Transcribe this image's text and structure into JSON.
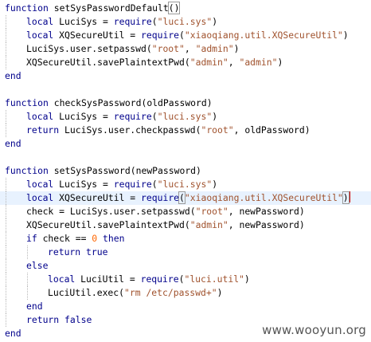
{
  "editor": {
    "current_line": 14,
    "lines": [
      {
        "indent": 0,
        "tokens": [
          {
            "t": "kw",
            "v": "function"
          },
          {
            "t": "plain",
            "v": " setSysPasswordDefault"
          },
          {
            "t": "paren",
            "v": "()"
          }
        ]
      },
      {
        "indent": 1,
        "tokens": [
          {
            "t": "kw",
            "v": "local"
          },
          {
            "t": "plain",
            "v": " LuciSys = "
          },
          {
            "t": "kw",
            "v": "require"
          },
          {
            "t": "plain",
            "v": "("
          },
          {
            "t": "str",
            "v": "\"luci.sys\""
          },
          {
            "t": "plain",
            "v": ")"
          }
        ]
      },
      {
        "indent": 1,
        "tokens": [
          {
            "t": "kw",
            "v": "local"
          },
          {
            "t": "plain",
            "v": " XQSecureUtil = "
          },
          {
            "t": "kw",
            "v": "require"
          },
          {
            "t": "plain",
            "v": "("
          },
          {
            "t": "str",
            "v": "\"xiaoqiang.util.XQSecureUtil\""
          },
          {
            "t": "plain",
            "v": ")"
          }
        ]
      },
      {
        "indent": 1,
        "tokens": [
          {
            "t": "plain",
            "v": "LuciSys.user.setpasswd("
          },
          {
            "t": "str",
            "v": "\"root\""
          },
          {
            "t": "plain",
            "v": ", "
          },
          {
            "t": "str",
            "v": "\"admin\""
          },
          {
            "t": "plain",
            "v": ")"
          }
        ]
      },
      {
        "indent": 1,
        "tokens": [
          {
            "t": "plain",
            "v": "XQSecureUtil.savePlaintextPwd("
          },
          {
            "t": "str",
            "v": "\"admin\""
          },
          {
            "t": "plain",
            "v": ", "
          },
          {
            "t": "str",
            "v": "\"admin\""
          },
          {
            "t": "plain",
            "v": ")"
          }
        ]
      },
      {
        "indent": 0,
        "tokens": [
          {
            "t": "kw",
            "v": "end"
          }
        ]
      },
      {
        "indent": 0,
        "tokens": []
      },
      {
        "indent": 0,
        "tokens": [
          {
            "t": "kw",
            "v": "function"
          },
          {
            "t": "plain",
            "v": " checkSysPassword(oldPassword)"
          }
        ]
      },
      {
        "indent": 1,
        "tokens": [
          {
            "t": "kw",
            "v": "local"
          },
          {
            "t": "plain",
            "v": " LuciSys = "
          },
          {
            "t": "kw",
            "v": "require"
          },
          {
            "t": "plain",
            "v": "("
          },
          {
            "t": "str",
            "v": "\"luci.sys\""
          },
          {
            "t": "plain",
            "v": ")"
          }
        ]
      },
      {
        "indent": 1,
        "tokens": [
          {
            "t": "kw",
            "v": "return"
          },
          {
            "t": "plain",
            "v": " LuciSys.user.checkpasswd("
          },
          {
            "t": "str",
            "v": "\"root\""
          },
          {
            "t": "plain",
            "v": ", oldPassword)"
          }
        ]
      },
      {
        "indent": 0,
        "tokens": [
          {
            "t": "kw",
            "v": "end"
          }
        ]
      },
      {
        "indent": 0,
        "tokens": []
      },
      {
        "indent": 0,
        "tokens": [
          {
            "t": "kw",
            "v": "function"
          },
          {
            "t": "plain",
            "v": " setSysPassword(newPassword)"
          }
        ]
      },
      {
        "indent": 1,
        "tokens": [
          {
            "t": "kw",
            "v": "local"
          },
          {
            "t": "plain",
            "v": " LuciSys = "
          },
          {
            "t": "kw",
            "v": "require"
          },
          {
            "t": "plain",
            "v": "("
          },
          {
            "t": "str",
            "v": "\"luci.sys\""
          },
          {
            "t": "plain",
            "v": ")"
          }
        ]
      },
      {
        "indent": 1,
        "tokens": [
          {
            "t": "kw",
            "v": "local"
          },
          {
            "t": "plain",
            "v": " XQSecureUtil = "
          },
          {
            "t": "kw",
            "v": "require"
          },
          {
            "t": "paren",
            "v": "("
          },
          {
            "t": "str",
            "v": "\"xiaoqiang.util.XQSecureUtil\""
          },
          {
            "t": "paren",
            "v": ")"
          },
          {
            "t": "caret",
            "v": ""
          }
        ]
      },
      {
        "indent": 1,
        "tokens": [
          {
            "t": "plain",
            "v": "check = LuciSys.user.setpasswd("
          },
          {
            "t": "str",
            "v": "\"root\""
          },
          {
            "t": "plain",
            "v": ", newPassword)"
          }
        ]
      },
      {
        "indent": 1,
        "tokens": [
          {
            "t": "plain",
            "v": "XQSecureUtil.savePlaintextPwd("
          },
          {
            "t": "str",
            "v": "\"admin\""
          },
          {
            "t": "plain",
            "v": ", newPassword)"
          }
        ]
      },
      {
        "indent": 1,
        "tokens": [
          {
            "t": "kw",
            "v": "if"
          },
          {
            "t": "plain",
            "v": " check == "
          },
          {
            "t": "num",
            "v": "0"
          },
          {
            "t": "plain",
            "v": " "
          },
          {
            "t": "kw",
            "v": "then"
          }
        ]
      },
      {
        "indent": 2,
        "tokens": [
          {
            "t": "kw",
            "v": "return"
          },
          {
            "t": "plain",
            "v": " "
          },
          {
            "t": "kw",
            "v": "true"
          }
        ]
      },
      {
        "indent": 1,
        "tokens": [
          {
            "t": "kw",
            "v": "else"
          }
        ]
      },
      {
        "indent": 2,
        "tokens": [
          {
            "t": "kw",
            "v": "local"
          },
          {
            "t": "plain",
            "v": " LuciUtil = "
          },
          {
            "t": "kw",
            "v": "require"
          },
          {
            "t": "plain",
            "v": "("
          },
          {
            "t": "str",
            "v": "\"luci.util\""
          },
          {
            "t": "plain",
            "v": ")"
          }
        ]
      },
      {
        "indent": 2,
        "tokens": [
          {
            "t": "plain",
            "v": "LuciUtil.exec("
          },
          {
            "t": "str",
            "v": "\"rm /etc/passwd+\""
          },
          {
            "t": "plain",
            "v": ")"
          }
        ]
      },
      {
        "indent": 1,
        "tokens": [
          {
            "t": "kw",
            "v": "end"
          }
        ]
      },
      {
        "indent": 1,
        "tokens": [
          {
            "t": "kw",
            "v": "return"
          },
          {
            "t": "plain",
            "v": " "
          },
          {
            "t": "kw",
            "v": "false"
          }
        ]
      },
      {
        "indent": 0,
        "tokens": [
          {
            "t": "kw",
            "v": "end"
          }
        ]
      }
    ]
  },
  "watermark": "www.wooyun.org",
  "colors": {
    "keyword": "#00008b",
    "string": "#a0522d",
    "number": "#ff6600",
    "current_line": "#e8f2fe",
    "caret": "#cc0000"
  }
}
